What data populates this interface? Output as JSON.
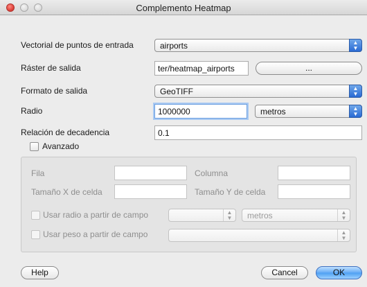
{
  "window": {
    "title": "Complemento Heatmap"
  },
  "form": {
    "input_layer": {
      "label": "Vectorial de puntos de entrada",
      "value": "airports"
    },
    "output_raster": {
      "label": "Ráster de salida",
      "value": "ter/heatmap_airports",
      "browse_label": "..."
    },
    "output_format": {
      "label": "Formato de salida",
      "value": "GeoTIFF"
    },
    "radius": {
      "label": "Radio",
      "value": "1000000",
      "unit": "metros"
    },
    "decay": {
      "label": "Relación de decadencia",
      "value": "0.1"
    },
    "advanced": {
      "label": "Avanzado",
      "checked": false
    }
  },
  "advanced": {
    "rows": {
      "label": "Fila",
      "value": ""
    },
    "columns": {
      "label": "Columna",
      "value": ""
    },
    "cell_x": {
      "label": "Tamaño X de celda",
      "value": ""
    },
    "cell_y": {
      "label": "Tamaño Y de celda",
      "value": ""
    },
    "radius_from_field": {
      "label": "Usar radio a partir de campo",
      "field_value": "",
      "unit": "metros"
    },
    "weight_from_field": {
      "label": "Usar peso a partir de campo",
      "field_value": ""
    }
  },
  "buttons": {
    "help": "Help",
    "cancel": "Cancel",
    "ok": "OK"
  },
  "colors": {
    "accent": "#4d9ff2",
    "close": "#e0443e",
    "window_bg": "#ececec"
  },
  "icons": {
    "popup_arrow": "updown-arrow-icon"
  }
}
